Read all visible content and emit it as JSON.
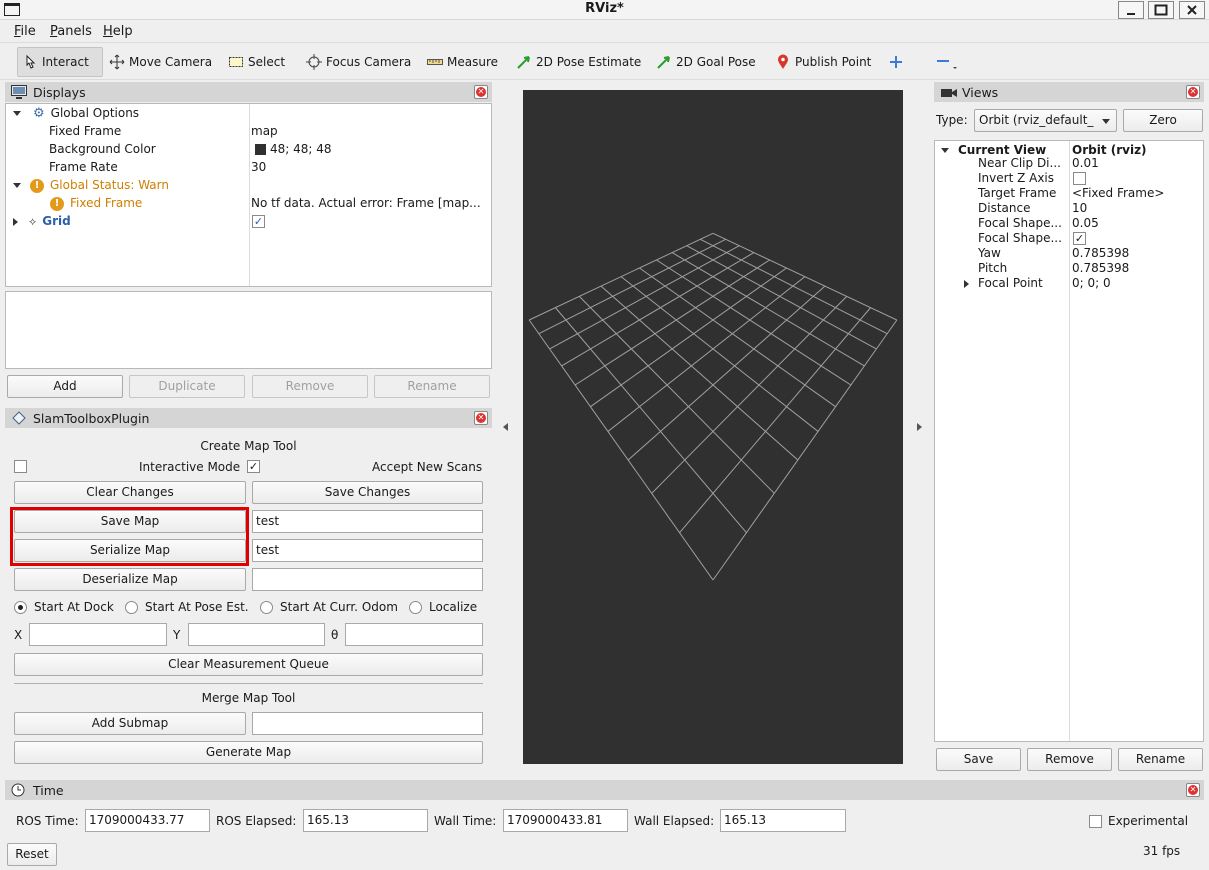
{
  "window": {
    "title": "RViz*"
  },
  "menubar": [
    {
      "label": "File",
      "key": "F",
      "rest": "ile"
    },
    {
      "label": "Panels",
      "key": "P",
      "rest": "anels"
    },
    {
      "label": "Help",
      "key": "H",
      "rest": "elp"
    }
  ],
  "toolbar": {
    "interact": "Interact",
    "move_camera": "Move Camera",
    "select": "Select",
    "focus_camera": "Focus Camera",
    "measure": "Measure",
    "pose_estimate": "2D Pose Estimate",
    "goal_pose": "2D Goal Pose",
    "publish_point": "Publish Point"
  },
  "displays": {
    "title": "Displays",
    "global_options": "Global Options",
    "fixed_frame_label": "Fixed Frame",
    "fixed_frame_value": "map",
    "bg_color_label": "Background Color",
    "bg_color_value": "48; 48; 48",
    "bg_color_swatch": "#303030",
    "frame_rate_label": "Frame Rate",
    "frame_rate_value": "30",
    "global_status": "Global Status: Warn",
    "status_fixed_frame": "Fixed Frame",
    "status_message": "No tf data.  Actual error: Frame [map...",
    "grid_label": "Grid",
    "grid_checked": "✓",
    "buttons": {
      "add": "Add",
      "duplicate": "Duplicate",
      "remove": "Remove",
      "rename": "Rename"
    }
  },
  "slam": {
    "title": "SlamToolboxPlugin",
    "create_map_tool": "Create Map Tool",
    "interactive_mode": "Interactive Mode",
    "accept_new_scans": "Accept New Scans",
    "accept_checked": "✓",
    "clear_changes": "Clear Changes",
    "save_changes": "Save Changes",
    "save_map": "Save Map",
    "save_map_value": "test",
    "serialize_map": "Serialize Map",
    "serialize_map_value": "test",
    "deserialize_map": "Deserialize Map",
    "deserialize_value": "",
    "start_at_dock": "Start At Dock",
    "start_at_pose": "Start At Pose Est.",
    "start_at_odom": "Start At Curr. Odom",
    "localize": "Localize",
    "x_label": "X",
    "y_label": "Y",
    "theta_label": "θ",
    "clear_measurement_queue": "Clear Measurement Queue",
    "merge_map_tool": "Merge Map Tool",
    "add_submap": "Add Submap",
    "generate_map": "Generate Map"
  },
  "views": {
    "title": "Views",
    "type_label": "Type:",
    "type_value": "Orbit (rviz_default_",
    "zero": "Zero",
    "current_view": "Current View",
    "current_view_value": "Orbit (rviz)",
    "props": [
      {
        "name": "Near Clip Di...",
        "value": "0.01"
      },
      {
        "name": "Invert Z Axis",
        "value": ""
      },
      {
        "name": "Target Frame",
        "value": "<Fixed Frame>"
      },
      {
        "name": "Distance",
        "value": "10"
      },
      {
        "name": "Focal Shape...",
        "value": "0.05"
      },
      {
        "name": "Focal Shape...",
        "value": "✓"
      },
      {
        "name": "Yaw",
        "value": "0.785398"
      },
      {
        "name": "Pitch",
        "value": "0.785398"
      },
      {
        "name": "Focal Point",
        "value": "0; 0; 0"
      }
    ],
    "save": "Save",
    "remove": "Remove",
    "rename": "Rename"
  },
  "time": {
    "title": "Time",
    "ros_time_label": "ROS Time:",
    "ros_time": "1709000433.77",
    "ros_elapsed_label": "ROS Elapsed:",
    "ros_elapsed": "165.13",
    "wall_time_label": "Wall Time:",
    "wall_time": "1709000433.81",
    "wall_elapsed_label": "Wall Elapsed:",
    "wall_elapsed": "165.13",
    "experimental": "Experimental",
    "reset": "Reset",
    "fps": "31 fps"
  },
  "viewport": {
    "bg": "#303030",
    "grid_color": "#a0a0a0",
    "highlight": "#e00000"
  }
}
